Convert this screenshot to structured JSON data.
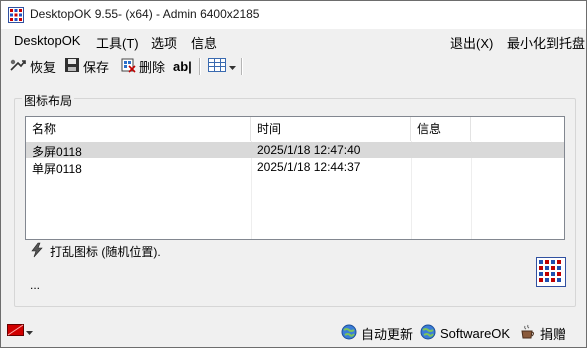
{
  "window": {
    "title": "DesktopOK 9.55- (x64) - Admin 6400x2185"
  },
  "menu": {
    "left": [
      "DesktopOK",
      "工具(T)",
      "选项",
      "信息"
    ],
    "right": [
      "退出(X)",
      "最小化到托盘"
    ]
  },
  "toolbar": {
    "restore": "恢复",
    "save": "保存",
    "delete": "删除",
    "rename": "ab|"
  },
  "group": {
    "label": "图标布局"
  },
  "table": {
    "columns": [
      "名称",
      "时间",
      "信息"
    ],
    "rows": [
      {
        "name": "多屏0118",
        "time": "2025/1/18 12:47:40",
        "info": ""
      },
      {
        "name": "单屏0118",
        "time": "2025/1/18 12:44:37",
        "info": ""
      }
    ]
  },
  "info_line": "打乱图标 (随机位置).",
  "ellipsis": "...",
  "statusbar": {
    "autoupdate": "自动更新",
    "softwareok": "SoftwareOK",
    "donate": "捐赠"
  },
  "colors": {
    "selection": "#d9d9d9",
    "border": "#828790",
    "accent": "#c00000"
  }
}
